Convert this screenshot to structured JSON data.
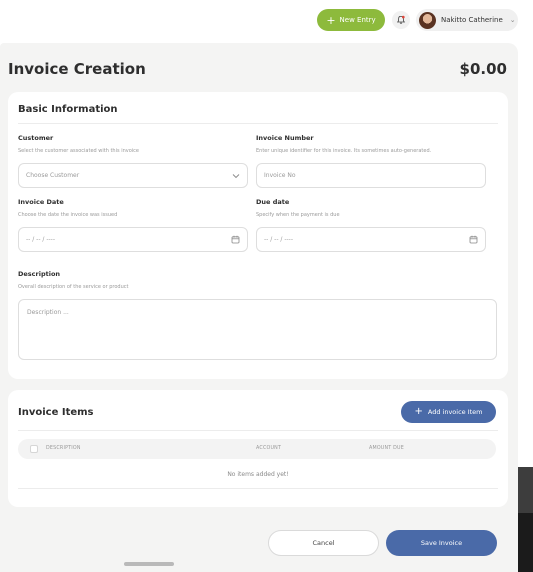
{
  "header": {
    "new_entry_label": "New Entry",
    "user_name": "Nakitto Catherine"
  },
  "page": {
    "title": "Invoice Creation",
    "total": "$0.00"
  },
  "basic_info": {
    "title": "Basic Information",
    "customer": {
      "label": "Customer",
      "hint": "Select the customer associated with this invoice",
      "placeholder": "Choose Customer"
    },
    "invoice_number": {
      "label": "Invoice Number",
      "hint": "Enter unique identifier for this invoice. Its sometimes auto-generated.",
      "placeholder": "Invoice No"
    },
    "invoice_date": {
      "label": "Invoice Date",
      "hint": "Choose the date the invoice was issued",
      "placeholder": "-- / -- / ----"
    },
    "due_date": {
      "label": "Due date",
      "hint": "Specify when the payment is due",
      "placeholder": "-- / -- / ----"
    },
    "description": {
      "label": "Description",
      "hint": "Overall description of the service or product",
      "placeholder": "Description ..."
    }
  },
  "invoice_items": {
    "title": "Invoice Items",
    "add_button_label": "Add invoice Item",
    "columns": [
      "DESCRIPTION",
      "ACCOUNT",
      "AMOUNT DUE"
    ],
    "empty_text": "No items added yet!"
  },
  "footer": {
    "cancel_label": "Cancel",
    "save_label": "Save Invoice"
  },
  "colors": {
    "accent_green": "#8dba3c",
    "primary_blue": "#4a6aa8",
    "notification_red": "#e0463b"
  },
  "icons": [
    "plus-icon",
    "bell-icon",
    "chevron-down-icon",
    "calendar-icon",
    "checkbox-icon"
  ]
}
